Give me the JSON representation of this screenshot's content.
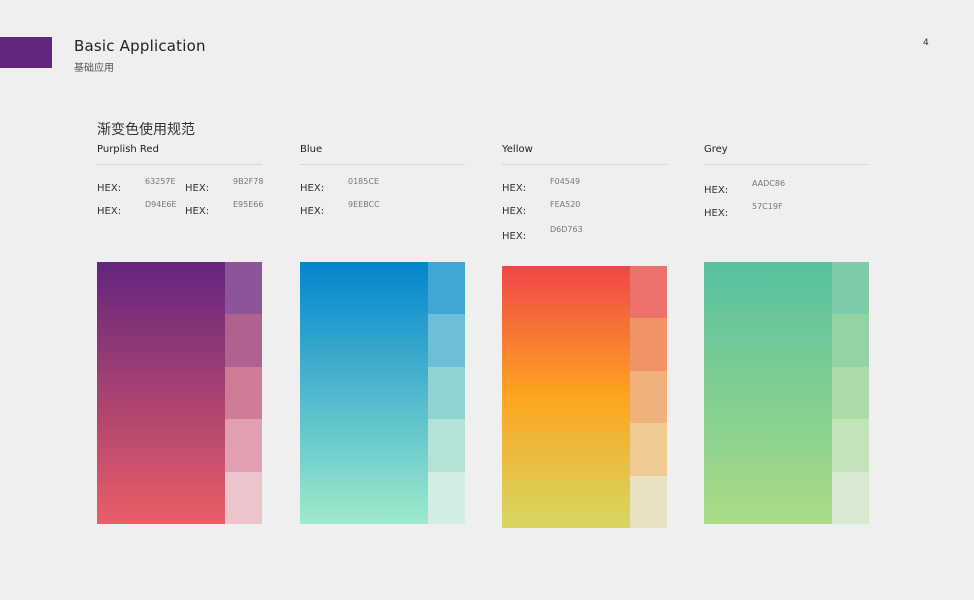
{
  "header": {
    "title": "Basic Application",
    "subtitle": "基础应用",
    "page_number": "4",
    "accent_color": "#63257E"
  },
  "section_title": "渐变色使用规范",
  "palettes": [
    {
      "name": "Purplish Red",
      "hex_label": "HEX:",
      "hex": [
        "63257E",
        "9B2F78",
        "D94E6E",
        "E95E66"
      ],
      "gradient": [
        "#63257E",
        "#E95E66"
      ],
      "swatches": [
        "#8E5499",
        "#B16190",
        "#CF7B96",
        "#E1A0B1",
        "#ECC5CC"
      ]
    },
    {
      "name": "Blue",
      "hex_label": "HEX:",
      "hex": [
        "0185CE",
        "9EEBCC"
      ],
      "gradient": [
        "#0185CE",
        "#9EEBCC"
      ],
      "swatches": [
        "#40A7D4",
        "#6DBFD6",
        "#91D3D2",
        "#B3E2D9",
        "#D3EDE3"
      ]
    },
    {
      "name": "Yellow",
      "hex_label": "HEX:",
      "hex": [
        "F04549",
        "FEA520",
        "D6D763"
      ],
      "gradient": [
        "#F04549",
        "#FEA520",
        "#D6D763"
      ],
      "swatches": [
        "#EC706C",
        "#F09466",
        "#F0B27A",
        "#EFCB93",
        "#E9E1C3"
      ]
    },
    {
      "name": "Grey",
      "hex_label": "HEX:",
      "hex": [
        "AADC86",
        "57C19F"
      ],
      "gradient": [
        "#57C19F",
        "#AADC86"
      ],
      "swatches": [
        "#7ECBAA",
        "#94D3A6",
        "#ACDBA8",
        "#C3E4BA",
        "#D9EAD2"
      ]
    }
  ]
}
